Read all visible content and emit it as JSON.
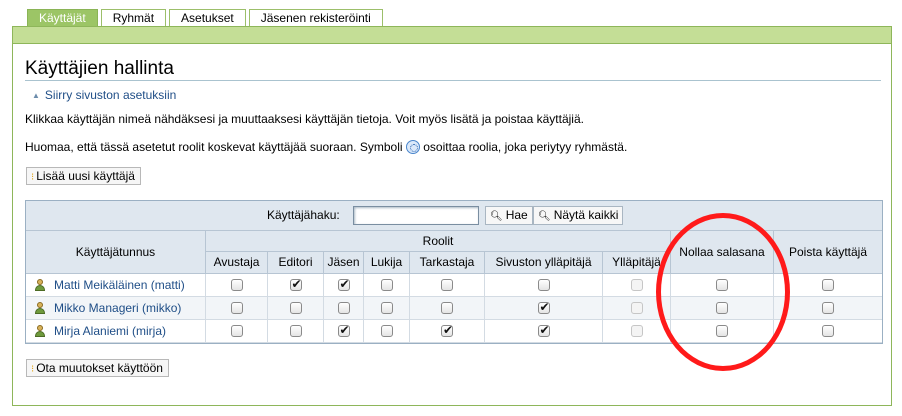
{
  "tabs": [
    "Käyttäjät",
    "Ryhmät",
    "Asetukset",
    "Jäsenen rekisteröinti"
  ],
  "page": {
    "title": "Käyttäjien hallinta",
    "site_settings_link": "Siirry sivuston asetuksiin",
    "intro": "Klikkaa käyttäjän nimeä nähdäksesi ja muuttaaksesi käyttäjän tietoja. Voit myös lisätä ja poistaa käyttäjiä.",
    "note_before": "Huomaa, että tässä asetetut roolit koskevat käyttäjää suoraan. Symboli",
    "note_after": "osoittaa roolia, joka periytyy ryhmästä.",
    "add_user_button": "Lisää uusi käyttäjä",
    "apply_button": "Ota muutokset käyttöön"
  },
  "search": {
    "label": "Käyttäjähaku:",
    "value": "",
    "search_button": "Hae",
    "show_all_button": "Näytä kaikki"
  },
  "table": {
    "username_header": "Käyttäjätunnus",
    "roles_header": "Roolit",
    "role_columns": [
      "Avustaja",
      "Editori",
      "Jäsen",
      "Lukija",
      "Tarkastaja",
      "Sivuston ylläpitäjä",
      "Ylläpitäjä"
    ],
    "reset_password_header": "Nollaa salasana",
    "delete_user_header": "Poista käyttäjä",
    "rows": [
      {
        "user": "Matti Meikäläinen (matti)",
        "roles": [
          false,
          true,
          true,
          false,
          false,
          false,
          false
        ],
        "reset": false,
        "delete": false
      },
      {
        "user": "Mikko Manageri (mikko)",
        "roles": [
          false,
          false,
          false,
          false,
          false,
          true,
          false
        ],
        "reset": false,
        "delete": false
      },
      {
        "user": "Mirja Alaniemi (mirja)",
        "roles": [
          false,
          false,
          true,
          false,
          true,
          true,
          false
        ],
        "reset": false,
        "delete": false
      }
    ]
  },
  "colors": {
    "tab_active": "#9cc566",
    "header_strip": "#c4de96",
    "link": "#1f4e87",
    "highlight_circle": "#ff1a1a"
  }
}
